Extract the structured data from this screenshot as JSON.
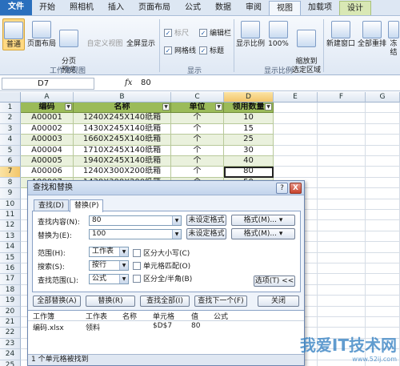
{
  "ribbon": {
    "tabs": [
      "文件",
      "开始",
      "照相机",
      "插入",
      "页面布局",
      "公式",
      "数据",
      "审阅",
      "视图",
      "加载项",
      "设计"
    ],
    "workbook_views": {
      "normal": "普通",
      "page_layout": "页面布局",
      "page_break": "分页\n预览",
      "custom_views": "自定义视图",
      "full_screen": "全屏显示",
      "group": "工作簿视图"
    },
    "show": {
      "ruler": "标尺",
      "formula_bar": "编辑栏",
      "gridlines": "网格线",
      "headings": "标题",
      "group": "显示"
    },
    "zoom": {
      "zoom": "显示比例",
      "zoom100": "100%",
      "zoom_selection": "缩放到\n选定区域",
      "group": "显示比例"
    },
    "window": {
      "new_window": "新建窗口",
      "arrange_all": "全部重排",
      "freeze": "冻结"
    }
  },
  "formula_bar": {
    "name_box": "D7",
    "fx": "fx",
    "value": "80"
  },
  "sheet": {
    "columns": [
      "A",
      "B",
      "C",
      "D",
      "E",
      "F",
      "G"
    ],
    "rows": [
      "1",
      "2",
      "3",
      "4",
      "5",
      "6",
      "7",
      "8",
      "9",
      "10",
      "11",
      "12",
      "13",
      "14",
      "15",
      "16",
      "17",
      "18",
      "19",
      "20",
      "21",
      "22",
      "23",
      "24",
      "25"
    ],
    "header": [
      "编码",
      "名称",
      "单位",
      "领用数量"
    ],
    "data": [
      [
        "A00001",
        "1240X245X140纸箱",
        "个",
        "10"
      ],
      [
        "A00002",
        "1430X245X140纸箱",
        "个",
        "15"
      ],
      [
        "A00003",
        "1660X245X140纸箱",
        "个",
        "25"
      ],
      [
        "A00004",
        "1710X245X140纸箱",
        "个",
        "30"
      ],
      [
        "A00005",
        "1940X245X140纸箱",
        "个",
        "40"
      ],
      [
        "A00006",
        "1240X300X200纸箱",
        "个",
        "80"
      ],
      [
        "A00007",
        "1430X300X200纸箱",
        "个",
        "50"
      ]
    ]
  },
  "dialog": {
    "title": "查找和替换",
    "help": "?",
    "close": "X",
    "tab_find": "查找(D)",
    "tab_replace": "替换(P)",
    "find_label": "查找内容(N):",
    "find_value": "80",
    "replace_label": "替换为(E):",
    "replace_value": "100",
    "no_format_1": "未设定格式",
    "no_format_2": "未设定格式",
    "format_1": "格式(M)...",
    "format_2": "格式(M)...",
    "scope_label": "范围(H):",
    "scope_value": "工作表",
    "search_label": "搜索(S):",
    "search_value": "按行",
    "lookin_label": "查找范围(L):",
    "lookin_value": "公式",
    "match_case": "区分大小写(C)",
    "match_entire": "单元格匹配(O)",
    "match_byte": "区分全/半角(B)",
    "options": "选项(T) <<",
    "replace_all": "全部替换(A)",
    "replace": "替换(R)",
    "find_all": "查找全部(I)",
    "find_next": "查找下一个(F)",
    "close_btn": "关闭",
    "results": {
      "headers": [
        "工作簿",
        "工作表",
        "名称",
        "单元格",
        "值",
        "公式"
      ],
      "rows": [
        [
          "编码.xlsx",
          "领料",
          "",
          "$D$7",
          "80",
          ""
        ]
      ]
    },
    "status": "1 个单元格被找到"
  },
  "watermark": {
    "title": "我爱IT技术网",
    "url": "www.52ij.com"
  }
}
